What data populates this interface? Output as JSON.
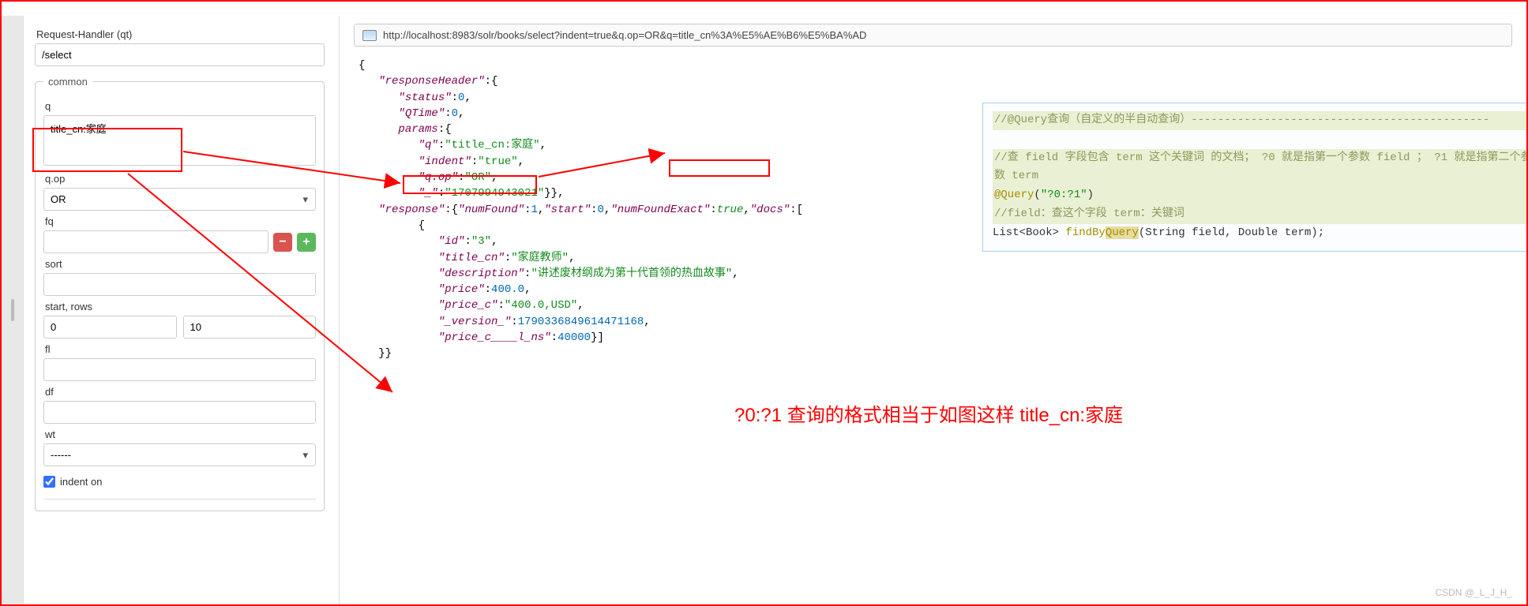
{
  "sidebar": {
    "request_handler_label": "Request-Handler (qt)",
    "request_handler_value": "/select",
    "common_legend": "common",
    "q_label": "q",
    "q_value": "title_cn:家庭",
    "qop_label": "q.op",
    "qop_value": "OR",
    "fq_label": "fq",
    "fq_value": "",
    "sort_label": "sort",
    "sort_value": "",
    "startrows_label": "start, rows",
    "start_value": "0",
    "rows_value": "10",
    "fl_label": "fl",
    "fl_value": "",
    "df_label": "df",
    "df_value": "",
    "wt_label": "wt",
    "wt_value": "------",
    "indent_label": "indent on",
    "minus_icon": "−",
    "plus_icon": "+"
  },
  "url_bar": {
    "text": "http://localhost:8983/solr/books/select?indent=true&q.op=OR&q=title_cn%3A%E5%AE%B6%E5%BA%AD"
  },
  "json": {
    "open": "{",
    "rh_key": "\"responseHeader\"",
    "status_key": "\"status\"",
    "status_val": "0",
    "qtime_key": "\"QTime\"",
    "qtime_val": "0",
    "params_key": "params",
    "q_key": "\"q\"",
    "q_val": "\"title_cn:家庭\"",
    "indent_key": "\"indent\"",
    "indent_val": "\"true\"",
    "qop_key": "\"q.op\"",
    "qop_val": "\"OR\"",
    "u_key": "\"_\"",
    "u_val": "\"1707994943021\"",
    "response_key": "\"response\"",
    "numfound_key": "\"numFound\"",
    "numfound_val": "1",
    "start_key": "\"start\"",
    "start_val": "0",
    "nfe_key": "\"numFoundExact\"",
    "nfe_val": "true",
    "docs_key": "\"docs\"",
    "id_key": "\"id\"",
    "id_val": "\"3\"",
    "title_key": "\"title_cn\"",
    "title_val": "\"家庭教师\"",
    "desc_key": "\"description\"",
    "desc_val": "\"讲述废材纲成为第十代首领的热血故事\"",
    "price_key": "\"price\"",
    "price_val": "400.0",
    "pricec_key": "\"price_c\"",
    "pricec_val": "\"400.0,USD\"",
    "ver_key": "\"_version_\"",
    "ver_val": "1790336849614471168",
    "pricens_key": "\"price_c____l_ns\"",
    "pricens_val": "40000",
    "close": "}}"
  },
  "code_panel": {
    "l1": "//@Query查询（自定义的半自动查询）---------------------------------------------",
    "l2": "//查 field 字段包含 term 这个关键词 的文档；   ?0 就是指第一个参数 field  ； ?1 就是指第二个参数 term",
    "l3a": "@Query",
    "l3b": "(",
    "l3c": "\"?0:?1\"",
    "l3d": ")",
    "l4": "//field：查这个字段       term：关键词",
    "l5a": "List<Book> ",
    "l5b": "findBy",
    "l5c": "Query",
    "l5d": "(String field, Double term);"
  },
  "bottom_note": {
    "text": "?0:?1    查询的格式相当于如图这样    title_cn:家庭"
  },
  "watermark": "CSDN @_L_J_H_"
}
